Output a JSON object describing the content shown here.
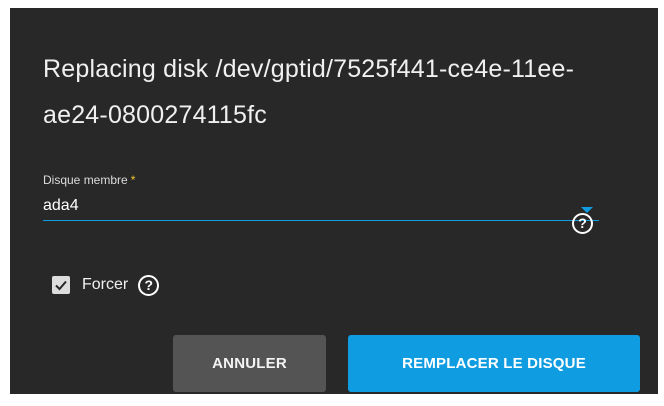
{
  "dialog": {
    "title": "Replacing disk /dev/gptid/7525f441-ce4e-11ee-ae24-0800274115fc",
    "member_disk": {
      "label": "Disque membre",
      "required_marker": "*",
      "value": "ada4",
      "help_icon": "help-circle-icon"
    },
    "force": {
      "label": "Forcer",
      "checked": true,
      "help_icon": "help-circle-icon"
    },
    "buttons": {
      "cancel": "ANNULER",
      "replace": "REMPLACER LE DISQUE"
    },
    "colors": {
      "background": "#282828",
      "accent": "#0f9ce0",
      "required": "#f4c430",
      "cancel_button": "#545454"
    }
  }
}
